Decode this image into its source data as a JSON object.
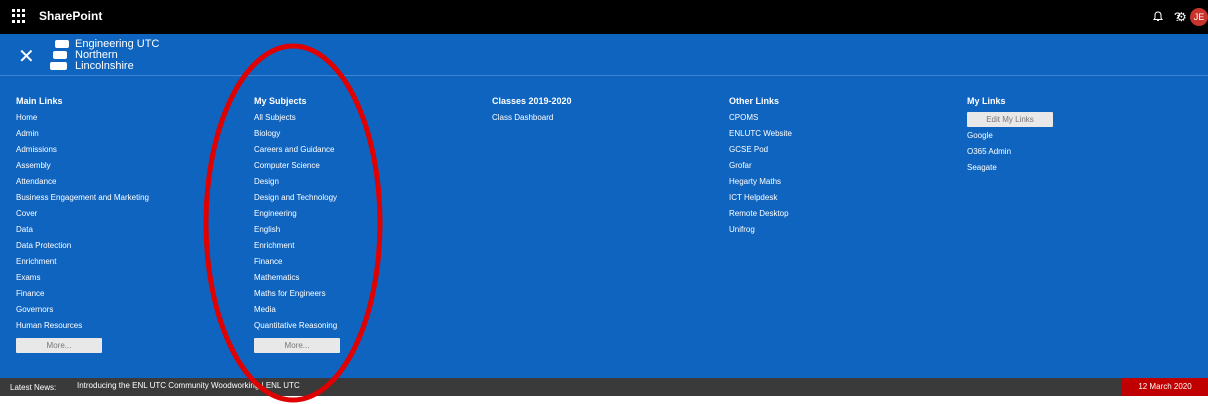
{
  "suitebar": {
    "app_name": "SharePoint",
    "help_label": "?",
    "avatar_initials": "JE"
  },
  "brand": {
    "logo_lines": [
      "Engineering UTC",
      "Northern",
      "Lincolnshire"
    ]
  },
  "columns": [
    {
      "title": "Main Links",
      "links": [
        "Home",
        "Admin",
        "Admissions",
        "Assembly",
        "Attendance",
        "Business Engagement and Marketing",
        "Cover",
        "Data",
        "Data Protection",
        "Enrichment",
        "Exams",
        "Finance",
        "Governors",
        "Human Resources"
      ],
      "button": "More..."
    },
    {
      "title": "My Subjects",
      "links": [
        "All Subjects",
        "Biology",
        "Careers and Guidance",
        "Computer Science",
        "Design",
        "Design and Technology",
        "Engineering",
        "English",
        "Enrichment",
        "Finance",
        "Mathematics",
        "Maths for Engineers",
        "Media",
        "Quantitative Reasoning"
      ],
      "button": "More..."
    },
    {
      "title": "Classes 2019-2020",
      "links": [
        "Class Dashboard"
      ]
    },
    {
      "title": "Other Links",
      "links": [
        "CPOMS",
        "ENLUTC Website",
        "GCSE Pod",
        "Grofar",
        "Hegarty Maths",
        "ICT Helpdesk",
        "Remote Desktop",
        "Unifrog"
      ]
    },
    {
      "title": "My Links",
      "edit_button": "Edit My Links",
      "links": [
        "Google",
        "O365 Admin",
        "Seagate"
      ]
    }
  ],
  "news": {
    "label": "Latest News:",
    "headline": "Introducing the ENL UTC Community Woodworking | ENL UTC",
    "date": "12 March 2020"
  },
  "colors": {
    "menu_bg": "#0f64c0",
    "suitebar_bg": "#000000",
    "avatar": "#c8332c",
    "date_box": "#c00000",
    "highlight_ring": "#e00000"
  }
}
